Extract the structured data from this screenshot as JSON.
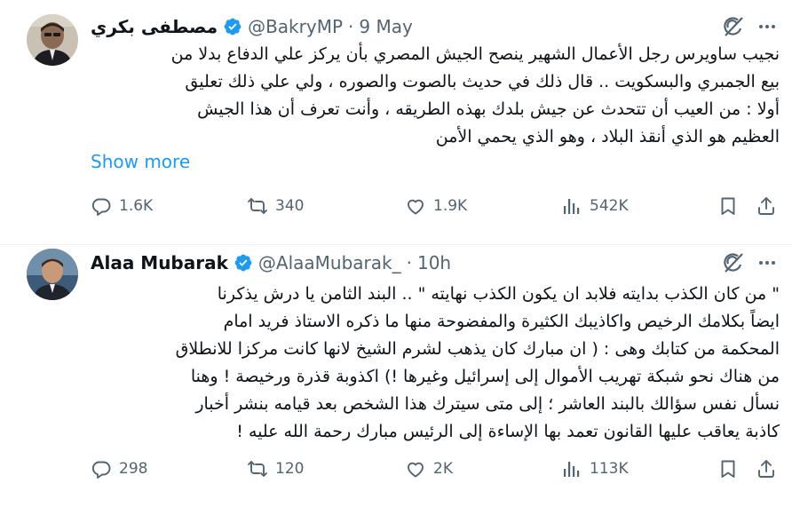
{
  "tweets": [
    {
      "author_name": "مصطفى بكري",
      "handle": "@BakryMP",
      "separator": "·",
      "time": "9 May",
      "text_lines": [
        "نجيب ساويرس رجل الأعمال الشهير ينصح الجيش المصري بأن يركز علي الدفاع بدلا من",
        "بيع الجمبري والبسكويت .. قال ذلك في حديث بالصوت والصوره ، ولي علي ذلك تعليق",
        "أولا : من العيب أن تتحدث عن جيش بلدك بهذه الطريقه ، وأنت تعرف أن هذا الجيش",
        "العظيم هو الذي أنقذ البلاد ، وهو الذي يحمي الأمن"
      ],
      "show_more": "Show more",
      "replies": "1.6K",
      "reposts": "340",
      "likes": "1.9K",
      "views": "542K"
    },
    {
      "author_name": "Alaa Mubarak",
      "handle": "@AlaaMubarak_",
      "separator": "·",
      "time": "10h",
      "text_lines": [
        "\" من كان الكذب بدايته فلابد ان يكون الكذب نهايته \" ..            البند الثامن يا درش يذكرنا",
        "ايضاً بكلامك الرخيص واكاذيبك الكثيرة والمفضوحة منها ما ذكره الاستاذ فريد امام",
        "المحكمة من كتابك وهى : ( ان مبارك كان يذهب لشرم الشيخ لانها كانت مركزا للانطلاق",
        "من هناك نحو شبكة تهريب الأموال إلى إسرائيل وغيرها !) اكذوبة قذرة ورخيصة ! وهنا",
        "نسأل نفس سؤالك بالبند العاشر ؛ إلى متى سيترك هذا الشخص بعد قيامه بنشر أخبار",
        "كاذبة يعاقب عليها القانون تعمد بها الإساءة إلى الرئيس مبارك رحمة الله عليه !"
      ],
      "replies": "298",
      "reposts": "120",
      "likes": "2K",
      "views": "113K"
    }
  ],
  "colors": {
    "text": "#0f1419",
    "secondary": "#536471",
    "link": "#1d9bf0",
    "verified": "#1d9bf0",
    "divider": "#eff3f4"
  },
  "icons": [
    "verified-badge-icon",
    "grok-icon",
    "more-icon",
    "reply-icon",
    "repost-icon",
    "like-icon",
    "views-icon",
    "bookmark-icon",
    "share-icon"
  ]
}
